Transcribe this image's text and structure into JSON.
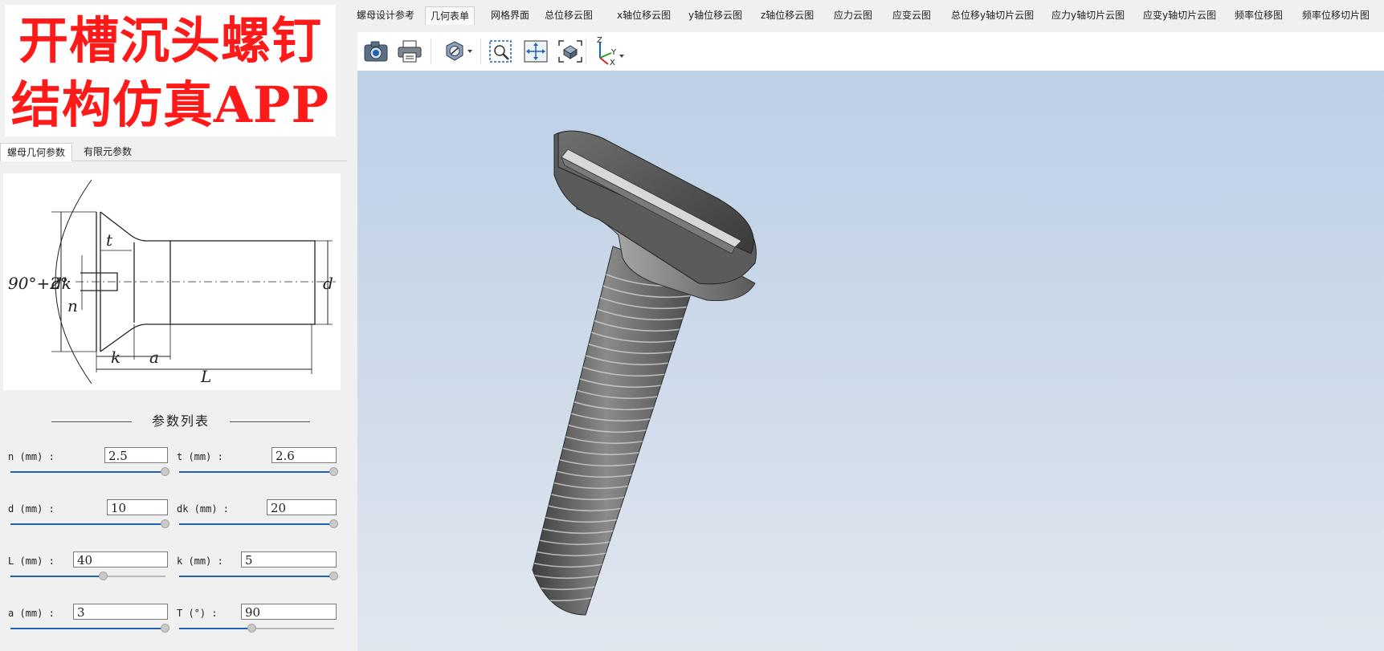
{
  "banner": {
    "line1": "开槽沉头螺钉",
    "line2": "结构仿真APP"
  },
  "left_tabs": [
    {
      "label": "螺母几何参数",
      "active": true
    },
    {
      "label": "有限元参数",
      "active": false
    }
  ],
  "diagram": {
    "labels": {
      "angle": "90°+2°",
      "dk": "dk",
      "n": "n",
      "t": "t",
      "d": "d",
      "k": "k",
      "a": "a",
      "L": "L"
    }
  },
  "params": {
    "title": "参数列表",
    "items": [
      {
        "label": "n (mm) :",
        "value": "2.5",
        "level": 1.0
      },
      {
        "label": "t (mm) :",
        "value": "2.6",
        "level": 1.0
      },
      {
        "label": "d (mm) :",
        "value": "10",
        "level": 1.0
      },
      {
        "label": "dk (mm) :",
        "value": "20",
        "level": 1.0
      },
      {
        "label": "L (mm) :",
        "value": "40",
        "level": 0.6
      },
      {
        "label": "k (mm) :",
        "value": "5",
        "level": 1.0
      },
      {
        "label": "a (mm) :",
        "value": "3",
        "level": 1.0
      },
      {
        "label": "T (°) :",
        "value": "90",
        "level": 0.47
      }
    ]
  },
  "top_tabs": [
    {
      "label": "螺母设计参考",
      "active": false
    },
    {
      "label": "几何表单",
      "active": true
    },
    {
      "label": "网格界面",
      "active": false
    },
    {
      "label": "总位移云图",
      "active": false
    },
    {
      "label": "x轴位移云图",
      "active": false
    },
    {
      "label": "y轴位移云图",
      "active": false
    },
    {
      "label": "z轴位移云图",
      "active": false
    },
    {
      "label": "应力云图",
      "active": false
    },
    {
      "label": "应变云图",
      "active": false
    },
    {
      "label": "总位移y轴切片云图",
      "active": false
    },
    {
      "label": "应力y轴切片云图",
      "active": false
    },
    {
      "label": "应变y轴切片云图",
      "active": false
    },
    {
      "label": "频率位移图",
      "active": false
    },
    {
      "label": "频率位移切片图",
      "active": false
    }
  ],
  "toolbar": {
    "buttons": [
      "camera-icon",
      "print-icon",
      "display-mode-icon",
      "zoom-box-icon",
      "pan-icon",
      "fit-view-icon",
      "axes-icon"
    ],
    "axes_labels": {
      "z": "Z",
      "y": "Y",
      "x": "X"
    }
  },
  "colors": {
    "banner_text": "#ff1a1a",
    "slider_fill": "#1e63b4",
    "viewport_top": "#bcd0e6",
    "viewport_bottom": "#e1e7ef"
  }
}
